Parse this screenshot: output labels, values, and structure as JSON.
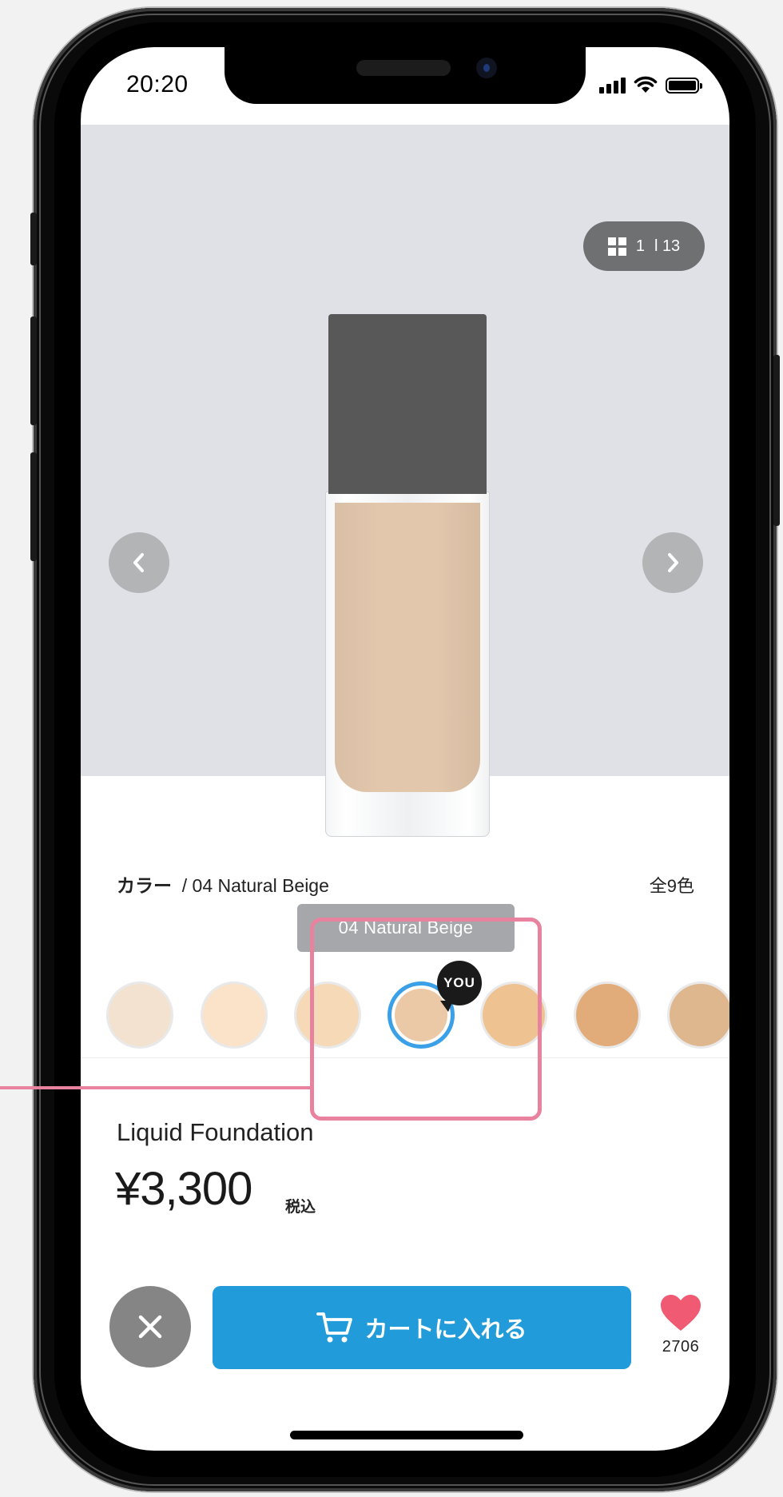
{
  "status_bar": {
    "time": "20:20"
  },
  "gallery": {
    "counter_current": "1",
    "counter_total": "l 13",
    "shade_label": "04 Natural Beige"
  },
  "color_selector": {
    "label": "カラー",
    "selected_name": "/ 04 Natural Beige",
    "count": "全9色",
    "you_badge": "YOU",
    "swatches": [
      "#f3e2d0",
      "#fbe3ca",
      "#f6d9b7",
      "#ecc9a6",
      "#efc292",
      "#e2ac7a",
      "#dfb78f"
    ],
    "selected_index": 3
  },
  "product": {
    "name": "Liquid Foundation",
    "price": "¥3,300",
    "tax_note": "税込"
  },
  "actions": {
    "cart_label": "カートに入れる",
    "favorite_count": "2706"
  },
  "colors": {
    "accent": "#219bd9",
    "selected_ring": "#3aa0e8",
    "favorite": "#f05a73",
    "callout": "#e8829f"
  }
}
